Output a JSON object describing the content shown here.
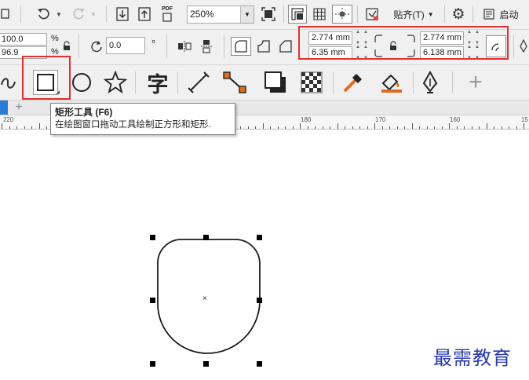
{
  "toolbar": {
    "pdf_label": "PDF",
    "zoom_value": "250%",
    "snap_label": "贴齐(T)",
    "launch_label": "启动"
  },
  "property_bar": {
    "scale_x": "100.0",
    "scale_y": "96.9",
    "percent_x": "%",
    "percent_y": "%",
    "rotation": "0.0",
    "degree_symbol": "°",
    "corner_top_left": "2.774 mm",
    "corner_bottom_left": "6.35 mm",
    "corner_top_right": "2.774 mm",
    "corner_bottom_right": "6.138 mm"
  },
  "toolbox": {
    "text_tool_glyph": "字",
    "add_tool_glyph": "+"
  },
  "ruler": {
    "labels": [
      "220",
      "180",
      "170",
      "160",
      "15"
    ]
  },
  "tooltip": {
    "title": "矩形工具 (F6)",
    "description": "在绘图窗口拖动工具绘制正方形和矩形."
  },
  "canvas": {
    "center_marker": "×"
  },
  "watermark": "最需教育",
  "colors": {
    "highlight": "#e03030",
    "accent_orange": "#e06b1a",
    "watermark": "#2a3aa8"
  }
}
